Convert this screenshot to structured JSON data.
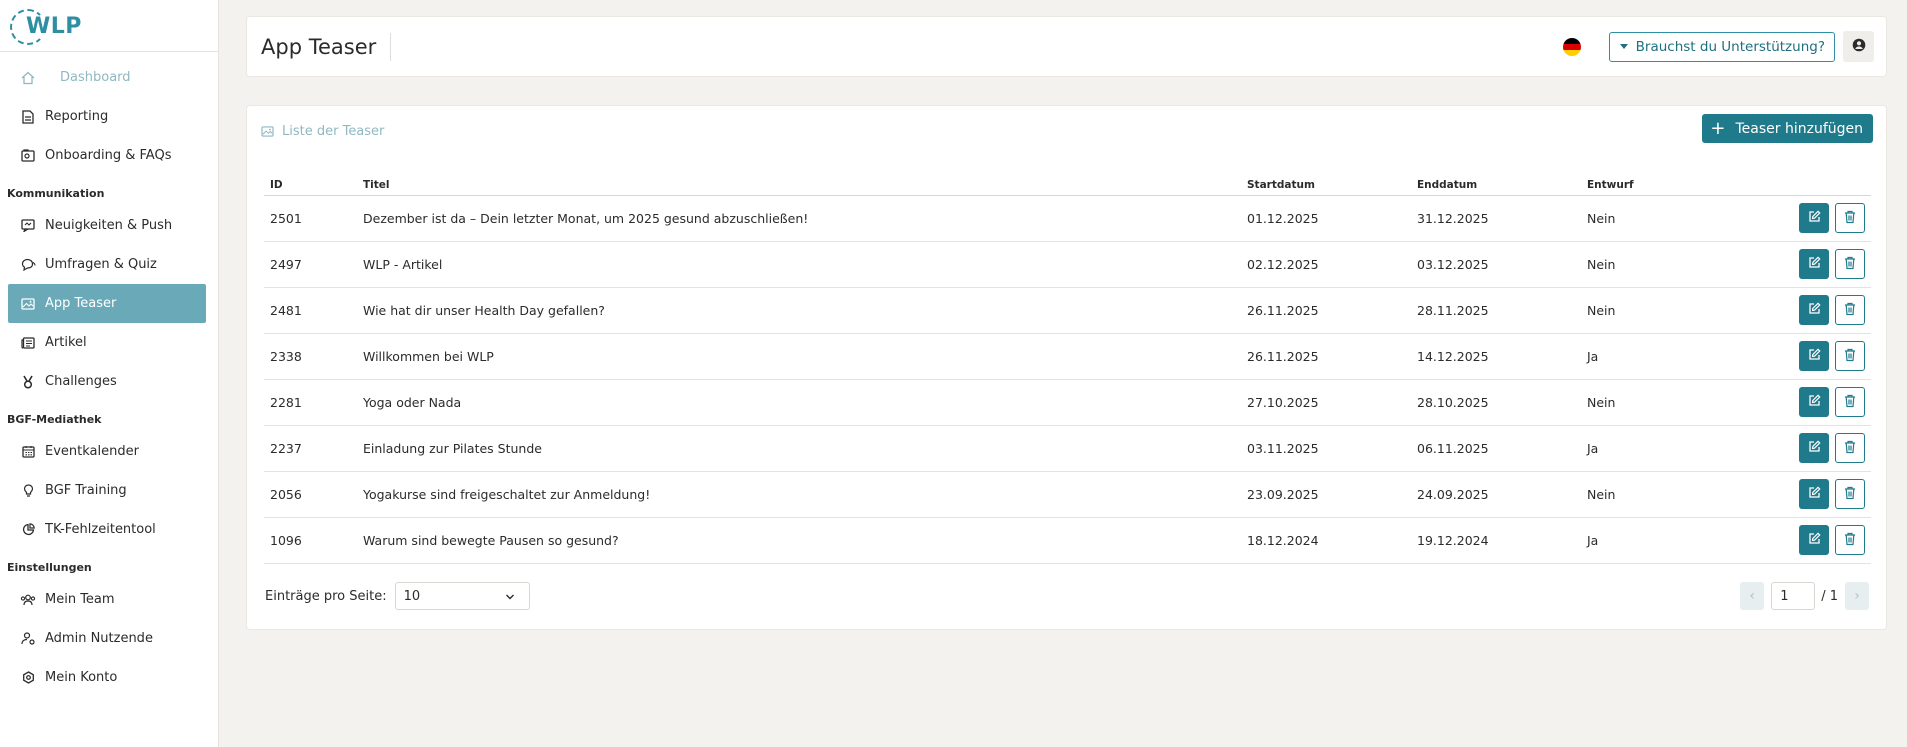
{
  "app": {
    "logo_text": "WLP"
  },
  "colors": {
    "accent": "#1f7a8c",
    "active_nav": "#6aaab8",
    "muted": "#8fb8c2"
  },
  "sidebar": {
    "top_items": [
      {
        "label": "Dashboard",
        "icon": "home-icon"
      },
      {
        "label": "Reporting",
        "icon": "document-icon"
      },
      {
        "label": "Onboarding & FAQs",
        "icon": "onboarding-icon"
      }
    ],
    "sections": [
      {
        "title": "Kommunikation",
        "items": [
          {
            "label": "Neuigkeiten & Push",
            "icon": "news-icon"
          },
          {
            "label": "Umfragen & Quiz",
            "icon": "chat-icon"
          },
          {
            "label": "App Teaser",
            "icon": "image-icon"
          },
          {
            "label": "Artikel",
            "icon": "newspaper-icon"
          },
          {
            "label": "Challenges",
            "icon": "medal-icon"
          }
        ]
      },
      {
        "title": "BGF-Mediathek",
        "items": [
          {
            "label": "Eventkalender",
            "icon": "calendar-icon"
          },
          {
            "label": "BGF Training",
            "icon": "lightbulb-icon"
          },
          {
            "label": "TK-Fehlzeitentool",
            "icon": "chart-icon"
          }
        ]
      },
      {
        "title": "Einstellungen",
        "items": [
          {
            "label": "Mein Team",
            "icon": "team-icon"
          },
          {
            "label": "Admin Nutzende",
            "icon": "admin-user-icon"
          },
          {
            "label": "Mein Konto",
            "icon": "settings-icon"
          }
        ]
      }
    ]
  },
  "header": {
    "title": "App Teaser",
    "support_label": "Brauchst du Unterstützung?"
  },
  "card": {
    "title": "Liste der Teaser",
    "add_label": "Teaser hinzufügen"
  },
  "table": {
    "headers": {
      "id": "ID",
      "title": "Titel",
      "start": "Startdatum",
      "end": "Enddatum",
      "draft": "Entwurf"
    },
    "rows": [
      {
        "id": "2501",
        "title": "Dezember ist da – Dein letzter Monat, um 2025 gesund abzuschließen!",
        "start": "01.12.2025",
        "end": "31.12.2025",
        "draft": "Nein"
      },
      {
        "id": "2497",
        "title": "WLP - Artikel",
        "start": "02.12.2025",
        "end": "03.12.2025",
        "draft": "Nein"
      },
      {
        "id": "2481",
        "title": "Wie hat dir unser Health Day gefallen?",
        "start": "26.11.2025",
        "end": "28.11.2025",
        "draft": "Nein"
      },
      {
        "id": "2338",
        "title": "Willkommen bei WLP",
        "start": "26.11.2025",
        "end": "14.12.2025",
        "draft": "Ja"
      },
      {
        "id": "2281",
        "title": "Yoga oder Nada",
        "start": "27.10.2025",
        "end": "28.10.2025",
        "draft": "Nein"
      },
      {
        "id": "2237",
        "title": "Einladung zur Pilates Stunde",
        "start": "03.11.2025",
        "end": "06.11.2025",
        "draft": "Ja"
      },
      {
        "id": "2056",
        "title": "Yogakurse sind freigeschaltet zur Anmeldung!",
        "start": "23.09.2025",
        "end": "24.09.2025",
        "draft": "Nein"
      },
      {
        "id": "1096",
        "title": "Warum sind bewegte Pausen so gesund?",
        "start": "18.12.2024",
        "end": "19.12.2024",
        "draft": "Ja"
      }
    ]
  },
  "pagination": {
    "per_page_label": "Einträge pro Seite:",
    "per_page_value": "10",
    "current_page": "1",
    "total_pages": "/ 1"
  }
}
